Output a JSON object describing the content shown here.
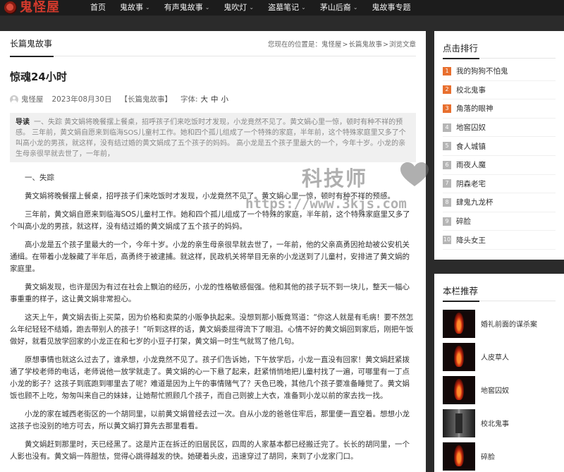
{
  "site": {
    "logo_text": "鬼怪屋"
  },
  "nav": [
    {
      "label": "首页",
      "has_menu": false
    },
    {
      "label": "鬼故事",
      "has_menu": true
    },
    {
      "label": "有声鬼故事",
      "has_menu": true
    },
    {
      "label": "鬼吹灯",
      "has_menu": true
    },
    {
      "label": "盗墓笔记",
      "has_menu": true
    },
    {
      "label": "茅山后裔",
      "has_menu": true
    },
    {
      "label": "鬼故事专题",
      "has_menu": false
    }
  ],
  "main": {
    "category_title": "长篇鬼故事",
    "breadcrumb": {
      "prefix": "您现在的位置是：",
      "items": [
        "鬼怪屋",
        "长篇鬼故事",
        "浏览文章"
      ],
      "separator": ">"
    },
    "article": {
      "title": "惊魂24小时",
      "author": "鬼怪屋",
      "date": "2023年08月30日",
      "category": "【长篇鬼故事】",
      "font_label": "字体:",
      "font_sizes": [
        "大",
        "中",
        "小"
      ],
      "lead_label": "导读",
      "lead_text": "一、失踪 黄文娟将晚餐摆上餐桌，招呼孩子们来吃饭时才发现，小龙竟然不见了。黄文娟心里一惊，顿时有种不祥的预感。 三年前，黄文娟自愿来到临海SOS儿童村工作。她和四个孤儿组成了一个特殊的家庭，半年前，这个特殊家庭里又多了个叫高小龙的男孩，就这样，没有结过婚的黄文娟成了五个孩子的妈妈。 高小龙是五个孩子里最大的一个，今年十岁。小龙的亲生母亲很早就去世了，一年前，",
      "paragraphs": [
        "一、失踪",
        "黄文娟将晚餐摆上餐桌，招呼孩子们来吃饭时才发现，小龙竟然不见了。黄文娟心里一惊，顿时有种不祥的预感。",
        "三年前，黄文娟自愿来到临海SOS儿童村工作。她和四个孤儿组成了一个特殊的家庭，半年前，这个特殊家庭里又多了个叫高小龙的男孩，就这样，没有结过婚的黄文娟成了五个孩子的妈妈。",
        "高小龙是五个孩子里最大的一个，今年十岁。小龙的亲生母亲很早就去世了，一年前，他的父亲高勇因抢劫被公安机关通缉。在带着小龙躲藏了半年后，高勇终于被逮捕。就这样，民政机关将举目无亲的小龙送到了儿童村，安排进了黄文娟的家庭里。",
        "黄文娟发现，也许是因为有过在社会上飘泊的经历，小龙的性格敏感倔强。他和其他的孩子玩不到一块儿，整天一幅心事重重的样子，这让黄文娟非常担心。",
        "这天上午，黄文娟去街上买菜，因为价格和卖菜的小贩争执起来。没想到那小贩竟骂道：“你这人就是有毛病！要不然怎么年纪轻轻不结婚，跑去带别人的孩子！”听到这样的话，黄文娟委屈得流下了眼泪。心情不好的黄文娟回到家后，刚把午饭做好，就看见放学回家的小龙正在和七岁的小豆子打架，黄文娟一时生气就骂了他几句。",
        "原想事情也就这么过去了，谁承想，小龙竟然不见了。孩子们告诉她，下午放学后，小龙一直没有回家！黄文娟赶紧拨通了学校老师的电话，老师说他一放学就走了。黄文娟的心一下悬了起来，赶紧悄悄地把儿童村找了一遍，可哪里有一丁点小龙的影子？这孩子到底跑到哪里去了呢？难道是因为上午的事情赌气了？天色已晚，其他几个孩子要准备睡觉了。黄文娟饭也顾不上吃，匆匆叫来自己的妹妹，让她帮忙照顾几个孩子，而自己则披上大衣，准备到小龙以前的家去找一找。",
        "小龙的家在城西老街区的一个胡同里，以前黄文娟曾经去过一次。自从小龙的爸爸住牢后，那里便一直空着。想想小龙这孩子也没别的地方可去，所以黄文娟打算先去那里看看。",
        "黄文娟赶到那里时，天已经黑了。这是片正在拆迁的旧居民区，四周的人家基本都已经搬迁完了。长长的胡同里，一个人影也没有。黄文娟一阵胆怯，觉得心跳得越发的快。她硬着头皮，迅速穿过了胡同，来到了小龙家门口。"
      ]
    }
  },
  "watermark": {
    "cn": "科技师",
    "url": "https://www.3kjs.com"
  },
  "ranking": {
    "title": "点击排行",
    "items": [
      {
        "num": "1",
        "label": "我的狗狗不怕鬼"
      },
      {
        "num": "2",
        "label": "校北鬼事"
      },
      {
        "num": "3",
        "label": "角落的眼神"
      },
      {
        "num": "4",
        "label": "地窖囚奴"
      },
      {
        "num": "5",
        "label": "食人城镇"
      },
      {
        "num": "6",
        "label": "雨夜人魔"
      },
      {
        "num": "7",
        "label": "阴森老宅"
      },
      {
        "num": "8",
        "label": "肆鬼九龙杯"
      },
      {
        "num": "9",
        "label": "碎脸"
      },
      {
        "num": "10",
        "label": "降头女王"
      }
    ],
    "hot_color": "#e86f2e"
  },
  "recommend": {
    "title": "本栏推荐",
    "items": [
      {
        "label": "婚礼前面的谋杀案",
        "thumb": "fire"
      },
      {
        "label": "人皮草人",
        "thumb": "fire"
      },
      {
        "label": "地窖囚奴",
        "thumb": "fire"
      },
      {
        "label": "校北鬼事",
        "thumb": "corr"
      },
      {
        "label": "碎脸",
        "thumb": "fire"
      }
    ]
  }
}
